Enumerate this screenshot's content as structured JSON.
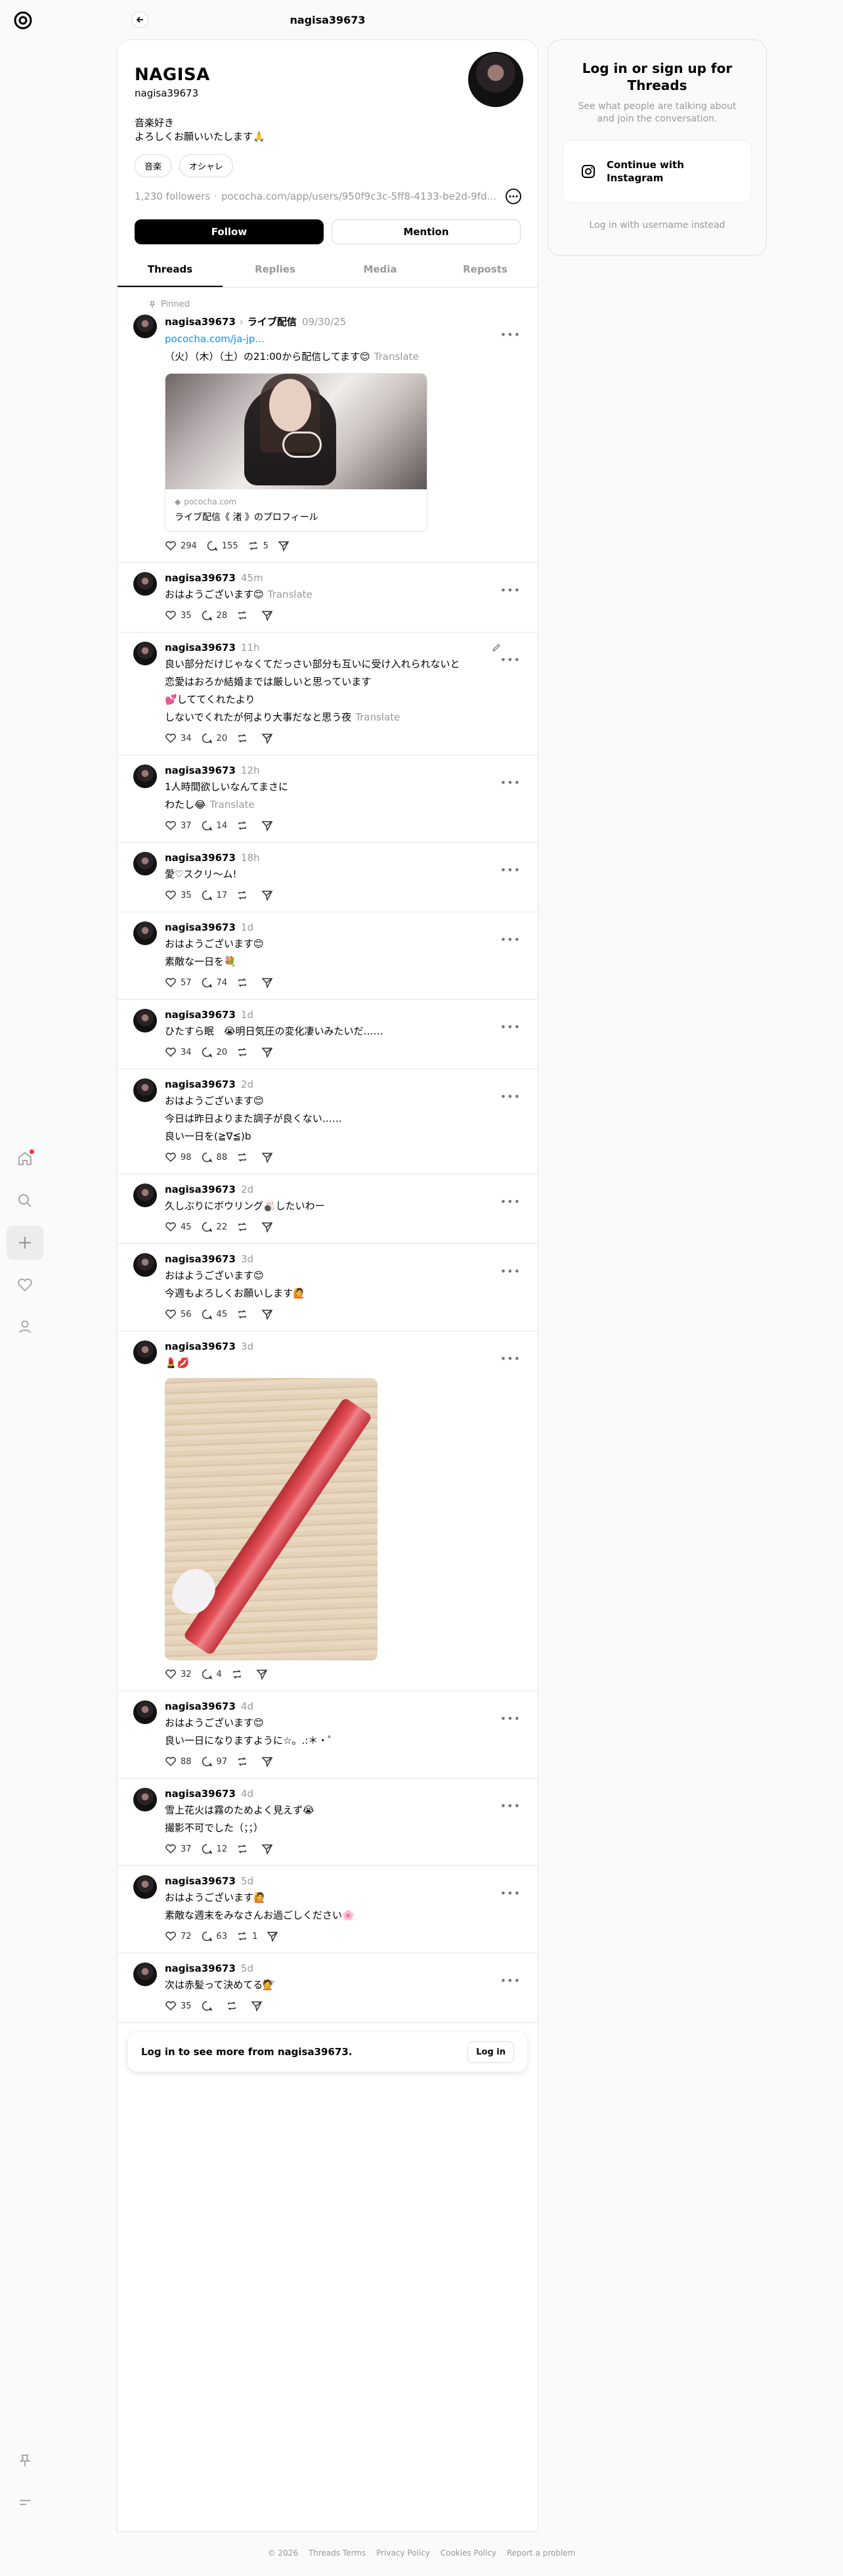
{
  "header": {
    "title": "nagisa39673"
  },
  "profile": {
    "name": "NAGISA",
    "handle": "nagisa39673",
    "bio_lines": [
      "音楽好き",
      "よろしくお願いいたします🙏"
    ],
    "tags": [
      "音楽",
      "オシャレ"
    ],
    "followers": "1,230 followers",
    "separator": "·",
    "url": "pococha.com/app/users/950f9c3c-5ff8-4133-be2d-9fd...",
    "follow_label": "Follow",
    "mention_label": "Mention"
  },
  "tabs": [
    "Threads",
    "Replies",
    "Media",
    "Reposts"
  ],
  "pinned_label": "Pinned",
  "translate_label": "Translate",
  "posts": [
    {
      "user": "nagisa39673",
      "tag": "ライブ配信",
      "time": "09/30/25",
      "link": "pococha.com/ja-jp...",
      "lines": [
        "（火）（木）（土）の21:00から配信してます😊"
      ],
      "translate": true,
      "likes": "294",
      "replies": "155",
      "reposts": "5",
      "shares": "",
      "card_domain": "pococha.com",
      "card_title": "ライブ配信《 渚 》のプロフィール"
    },
    {
      "user": "nagisa39673",
      "time": "45m",
      "lines": [
        "おはようございます😊"
      ],
      "translate": true,
      "likes": "35",
      "replies": "28",
      "reposts": "",
      "shares": ""
    },
    {
      "user": "nagisa39673",
      "time": "11h",
      "lines": [
        "良い部分だけじゃなくてだっさい部分も互いに受け入れられないと",
        "恋愛はおろか結婚までは厳しいと思っています",
        "💕しててくれたより",
        "しないでくれたが何より大事だなと思う夜"
      ],
      "translate": true,
      "likes": "34",
      "replies": "20",
      "reposts": "",
      "shares": ""
    },
    {
      "user": "nagisa39673",
      "time": "12h",
      "lines": [
        "1人時間欲しいなんてまさに",
        "わたし😂"
      ],
      "translate": true,
      "likes": "37",
      "replies": "14",
      "reposts": "",
      "shares": ""
    },
    {
      "user": "nagisa39673",
      "time": "18h",
      "lines": [
        "愛♡スクリ〜ム!"
      ],
      "likes": "35",
      "replies": "17",
      "reposts": "",
      "shares": ""
    },
    {
      "user": "nagisa39673",
      "time": "1d",
      "lines": [
        "おはようございます😊",
        "素敵な一日を💐"
      ],
      "likes": "57",
      "replies": "74",
      "reposts": "",
      "shares": ""
    },
    {
      "user": "nagisa39673",
      "time": "1d",
      "lines": [
        "ひたすら眠　😭明日気圧の変化凄いみたいだ……"
      ],
      "likes": "34",
      "replies": "20",
      "reposts": "",
      "shares": ""
    },
    {
      "user": "nagisa39673",
      "time": "2d",
      "lines": [
        "おはようございます😊",
        "今日は昨日よりまた調子が良くない……",
        "良い一日を(≧∇≦)b"
      ],
      "likes": "98",
      "replies": "88",
      "reposts": "",
      "shares": ""
    },
    {
      "user": "nagisa39673",
      "time": "2d",
      "lines": [
        "久しぶりにボウリング🎳したいわー"
      ],
      "likes": "45",
      "replies": "22",
      "reposts": "",
      "shares": ""
    },
    {
      "user": "nagisa39673",
      "time": "3d",
      "lines": [
        "おはようございます😊",
        "今週もよろしくお願いします🙋"
      ],
      "likes": "56",
      "replies": "45",
      "reposts": "",
      "shares": ""
    },
    {
      "user": "nagisa39673",
      "time": "3d",
      "lines": [
        "💄💋"
      ],
      "likes": "32",
      "replies": "4",
      "reposts": "",
      "shares": ""
    },
    {
      "user": "nagisa39673",
      "time": "4d",
      "lines": [
        "おはようございます😊",
        "良い一日になりますように☆。.:＊・゜"
      ],
      "likes": "88",
      "replies": "97",
      "reposts": "",
      "shares": ""
    },
    {
      "user": "nagisa39673",
      "time": "4d",
      "lines": [
        "雪上花火は霧のためよく見えず😭",
        "撮影不可でした（；；）"
      ],
      "likes": "37",
      "replies": "12",
      "reposts": "",
      "shares": ""
    },
    {
      "user": "nagisa39673",
      "time": "5d",
      "lines": [
        "おはようございます🙋",
        "素敵な週末をみなさんお過ごしください🌸"
      ],
      "likes": "72",
      "replies": "63",
      "reposts": "1",
      "shares": ""
    },
    {
      "user": "nagisa39673",
      "time": "5d",
      "lines": [
        "次は赤髪って決めてる💇"
      ],
      "likes": "35",
      "replies": "",
      "reposts": "",
      "shares": ""
    }
  ],
  "login_banner": {
    "text": "Log in to see more from nagisa39673.",
    "button": "Log in"
  },
  "side": {
    "title": "Log in or sign up for Threads",
    "subtitle": "See what people are talking about and join the conversation.",
    "instagram_button": "Continue with Instagram",
    "alt_login": "Log in with username instead"
  },
  "footer": [
    "© 2026",
    "Threads Terms",
    "Privacy Policy",
    "Cookies Policy",
    "Report a problem"
  ],
  "colors": {
    "accent": "#000000",
    "muted": "#999999",
    "notification": "#ff3040",
    "link": "#0095f6"
  },
  "icons": [
    "threads-logo-icon",
    "home-icon",
    "search-icon",
    "plus-icon",
    "heart-icon",
    "user-icon",
    "pin-icon",
    "menu-icon",
    "back-arrow-icon",
    "more-icon",
    "like-icon",
    "reply-icon",
    "repost-icon",
    "share-icon",
    "instagram-icon",
    "edit-icon"
  ]
}
